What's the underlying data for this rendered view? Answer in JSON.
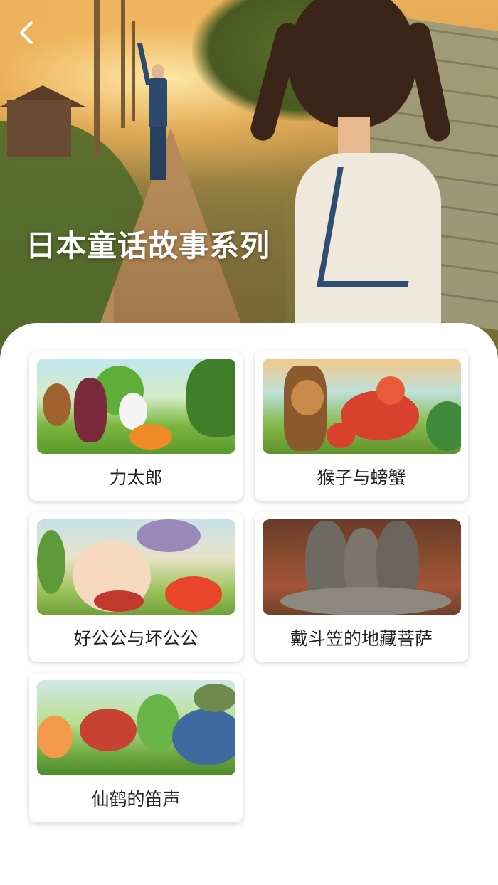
{
  "header": {
    "title": "日本童话故事系列",
    "back_icon": "chevron-left-icon"
  },
  "stories": [
    {
      "title": "力太郎"
    },
    {
      "title": "猴子与螃蟹"
    },
    {
      "title": "好公公与坏公公"
    },
    {
      "title": "戴斗笠的地藏菩萨"
    },
    {
      "title": "仙鹤的笛声"
    }
  ],
  "colors": {
    "panel_background": "#ffffff",
    "title_text": "#ffffff",
    "card_label_text": "#222222"
  }
}
